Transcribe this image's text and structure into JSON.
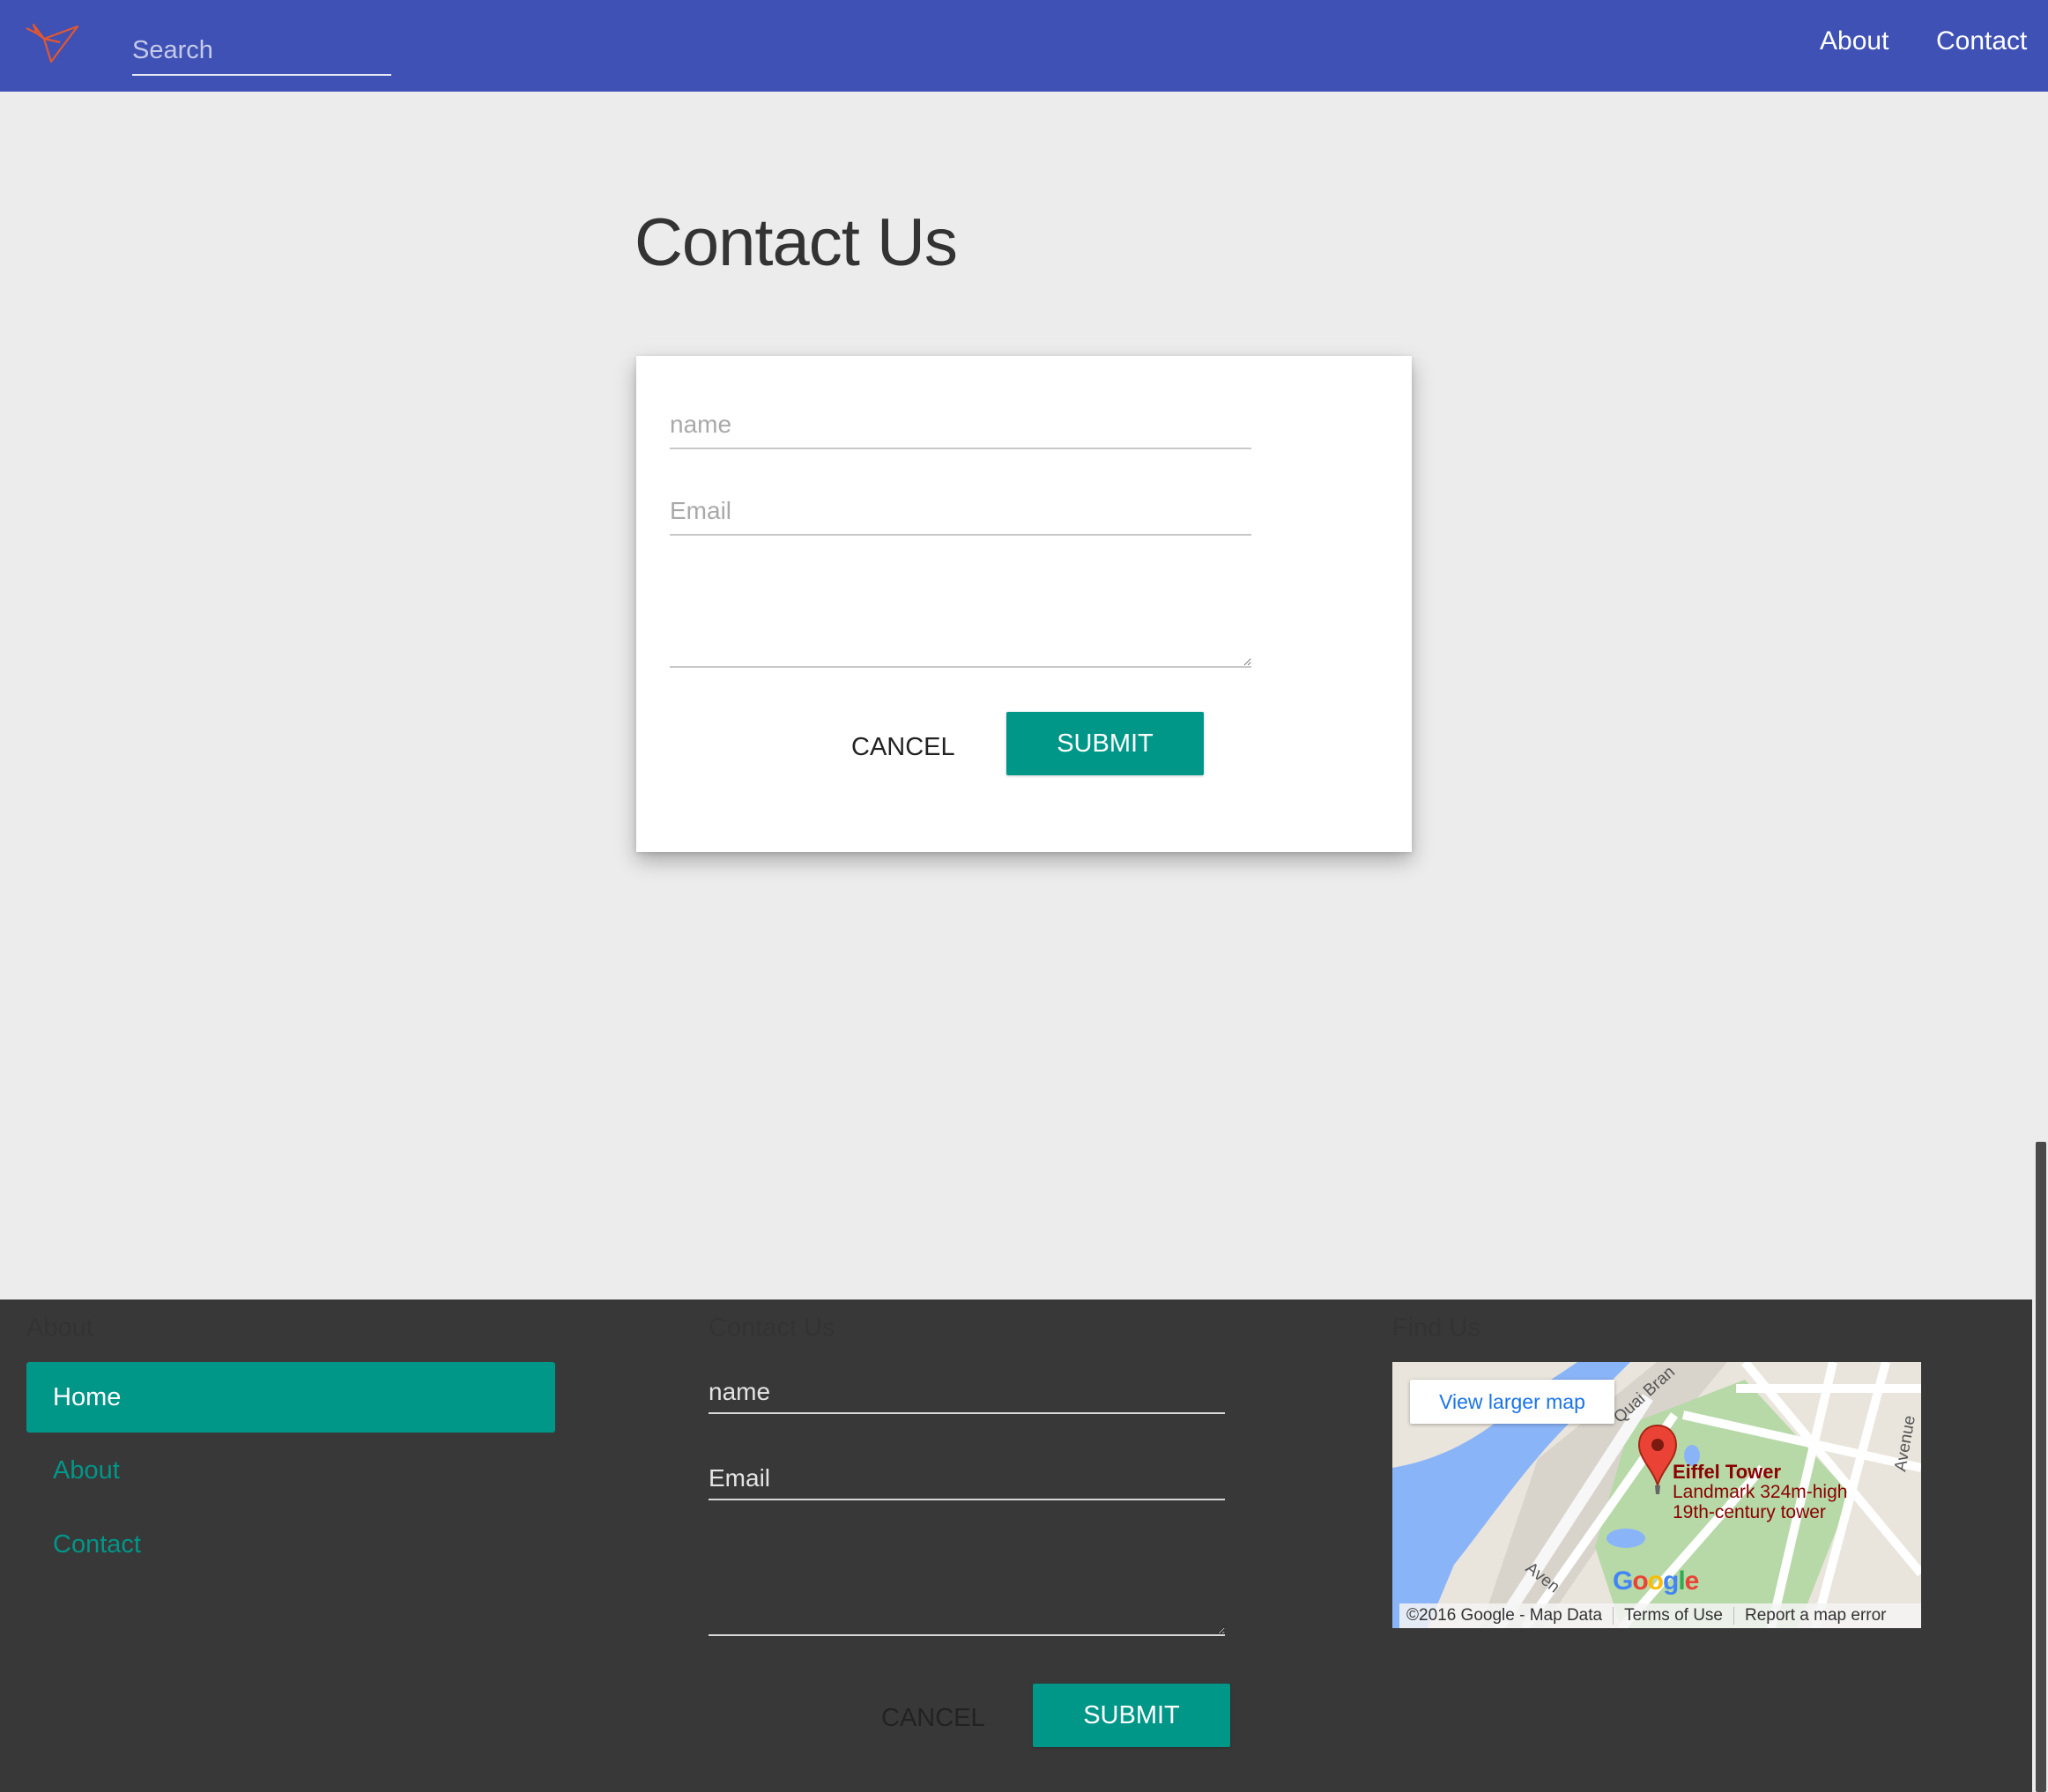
{
  "nav": {
    "search_placeholder": "Search",
    "links": [
      "About",
      "Contact"
    ],
    "bar_color": "#3f51b5",
    "logo_icon": "origami-bird-icon"
  },
  "main": {
    "title": "Contact Us",
    "form": {
      "name_placeholder": "name",
      "email_placeholder": "Email",
      "message_value": "",
      "cancel_label": "CANCEL",
      "submit_label": "SUBMIT"
    }
  },
  "footer": {
    "headings": {
      "about": "About",
      "contact": "Contact Us",
      "find": "Find Us"
    },
    "nav": [
      {
        "label": "Home",
        "active": true
      },
      {
        "label": "About",
        "active": false
      },
      {
        "label": "Contact",
        "active": false
      }
    ],
    "form": {
      "name_placeholder": "name",
      "email_placeholder": "Email",
      "cancel_label": "CANCEL",
      "submit_label": "SUBMIT"
    },
    "map": {
      "view_larger_label": "View larger map",
      "place_name": "Eiffel Tower",
      "place_desc_1": "Landmark 324m-high",
      "place_desc_2": "19th-century tower",
      "street_labels": [
        "Quai Bran",
        "Avenue",
        "Aven"
      ],
      "google_letters": [
        "G",
        "o",
        "o",
        "g",
        "l",
        "e"
      ],
      "attribution": "©2016 Google - Map Data",
      "terms": "Terms of Use",
      "report": "Report a map error"
    }
  },
  "colors": {
    "accent": "#009688",
    "page_bg": "#ececec",
    "footer_bg": "#383838"
  }
}
